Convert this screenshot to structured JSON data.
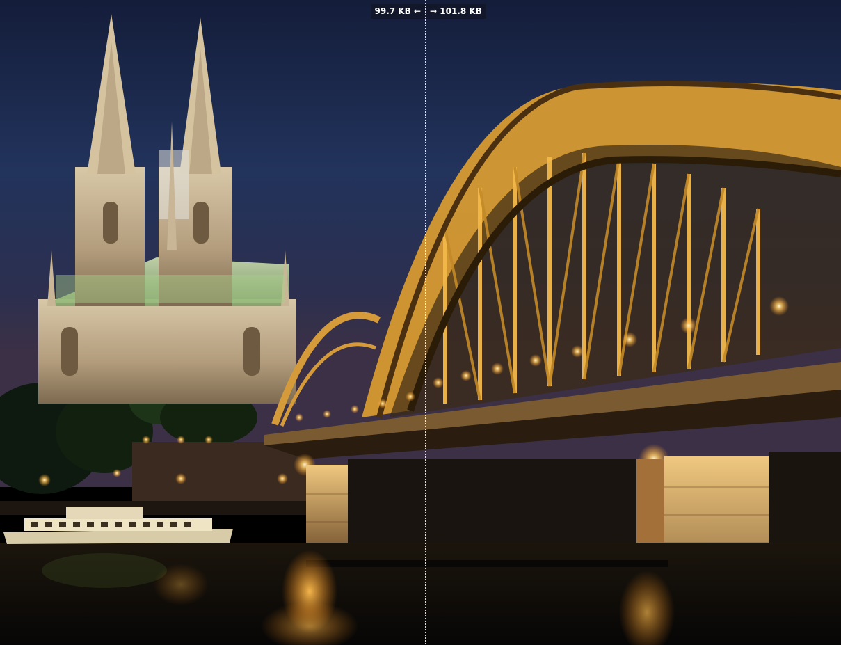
{
  "compare": {
    "left_size": "99.7 KB",
    "left_arrow": "←",
    "right_arrow": "→",
    "right_size": "101.8 KB"
  },
  "colors": {
    "sky_top": "#14203f",
    "sky_mid": "#22345f",
    "sky_low": "#3a3450",
    "bridge_gold": "#e0a030",
    "bridge_dark": "#5a3a10",
    "light_glow": "#ffcf70",
    "water": "#0b0a0a",
    "cathedral_light": "#c8b79a",
    "roof_green": "#9ec08a",
    "badge_bg": "#121628"
  },
  "scene": {
    "subject_left": "cathedral-at-night",
    "subject_right": "arched-steel-bridge",
    "foreground": "river-with-reflections",
    "boat": "river-cruise-boat"
  }
}
